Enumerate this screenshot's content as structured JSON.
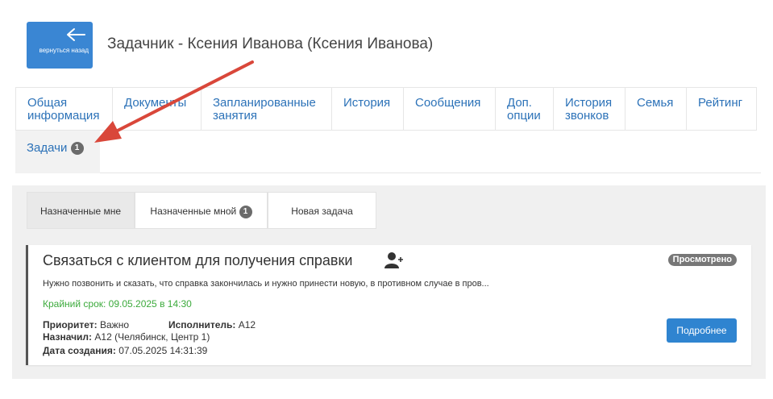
{
  "header": {
    "back_label": "вернуться назад",
    "title": "Задачник - Ксения Иванова (Ксения Иванова)"
  },
  "tabs": [
    {
      "label": "Общая информация"
    },
    {
      "label": "Документы"
    },
    {
      "label": "Запланированные занятия"
    },
    {
      "label": "История"
    },
    {
      "label": "Сообщения"
    },
    {
      "label": "Доп. опции"
    },
    {
      "label": "История звонков"
    },
    {
      "label": "Семья"
    },
    {
      "label": "Рейтинг"
    },
    {
      "label": "Задачи",
      "badge": "1",
      "active": true
    }
  ],
  "subtabs": [
    {
      "label": "Назначенные мне",
      "active": true
    },
    {
      "label": "Назначенные мной",
      "badge": "1"
    },
    {
      "label": "Новая задача"
    }
  ],
  "task": {
    "title": "Связаться с клиентом для получения справки",
    "status": "Просмотрено",
    "description": "Нужно позвонить и сказать, что справка закончилась и нужно принести новую, в противном случае в пров...",
    "deadline": "Крайний срок: 09.05.2025 в 14:30",
    "priority_label": "Приоритет:",
    "priority_value": "Важно",
    "executor_label": "Исполнитель:",
    "executor_value": "А12",
    "assigned_by_label": "Назначил:",
    "assigned_by_value": "А12 (Челябинск, Центр 1)",
    "created_label": "Дата создания:",
    "created_value": "07.05.2025 14:31:39",
    "more_button": "Подробнее"
  },
  "colors": {
    "accent": "#3a86d3",
    "deadline": "#3caa3c",
    "badge": "#6b6b6b",
    "annotation_arrow": "#d9473a"
  },
  "icons": {
    "back": "arrow-left-icon",
    "assign": "user-plus-icon"
  }
}
